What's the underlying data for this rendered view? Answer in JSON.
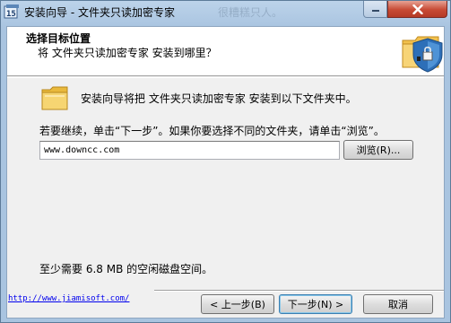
{
  "window": {
    "title": "安装向导 - 文件夹只读加密专家",
    "title_ghost": "很糟糕只人。"
  },
  "header": {
    "title": "选择目标位置",
    "subtitle": "将 文件夹只读加密专家 安装到哪里？"
  },
  "body": {
    "intro": "安装向导将把 文件夹只读加密专家 安装到以下文件夹中。",
    "hint": "若要继续，单击“下一步”。如果你要选择不同的文件夹，请单击“浏览”。",
    "path_value": "www.downcc.com",
    "browse_label": "浏览(R)...",
    "space_required": "至少需要 6.8 MB 的空闲磁盘空间。"
  },
  "footer": {
    "website": "http://www.jiamisoft.com/",
    "back_label": "< 上一步(B)",
    "next_label": "下一步(N) >",
    "cancel_label": "取消"
  },
  "colors": {
    "accent": "#3c7fb1",
    "close": "#c74a34",
    "link": "#0000ee"
  }
}
